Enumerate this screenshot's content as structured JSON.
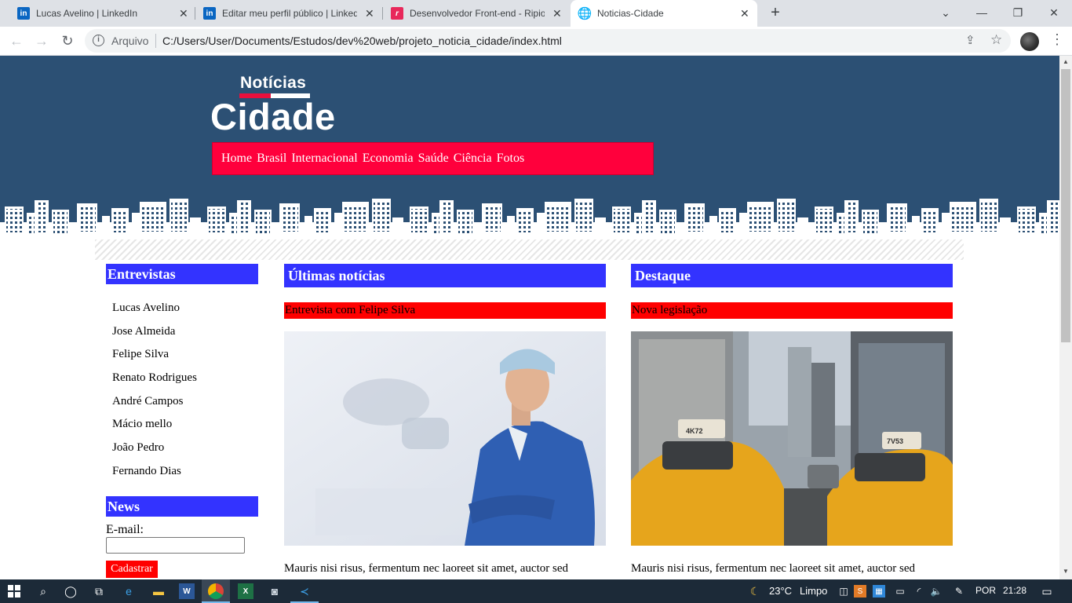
{
  "browser": {
    "tabs": [
      {
        "title": "Lucas Avelino | LinkedIn",
        "favicon": "linkedin-icon"
      },
      {
        "title": "Editar meu perfil público | LinkedIn",
        "favicon": "linkedin-icon"
      },
      {
        "title": "Desenvolvedor Front-end - Ripio",
        "favicon": "ripio-icon"
      },
      {
        "title": "Noticias-Cidade",
        "favicon": "globe-icon"
      }
    ],
    "favicon_letters": {
      "linkedin": "in",
      "ripio": "r"
    },
    "scheme_label": "Arquivo",
    "url": "C:/Users/User/Documents/Estudos/dev%20web/projeto_noticia_cidade/index.html"
  },
  "site": {
    "logo_top": "Notícias",
    "logo_main": "Cidade",
    "menu": [
      "Home",
      "Brasil",
      "Internacional",
      "Economia",
      "Saúde",
      "Ciência",
      "Fotos"
    ],
    "colors": {
      "header_bg": "#2c5074",
      "menu_bg": "#ff003c",
      "section_bg": "#3333ff",
      "subtitle_bg": "#ff0000"
    }
  },
  "sidebar": {
    "interviews_title": "Entrevistas",
    "interviews": [
      "Lucas Avelino",
      "Jose Almeida",
      "Felipe Silva",
      "Renato Rodrigues",
      "André Campos",
      "Mácio mello",
      "João Pedro",
      "Fernando Dias"
    ],
    "news_title": "News",
    "email_label": "E-mail:",
    "submit_label": "Cadastrar"
  },
  "latest": {
    "title": "Últimas notícias",
    "subtitle": "Entrevista com Felipe Silva",
    "body": "Mauris nisi risus, fermentum nec laoreet sit amet, auctor sed"
  },
  "featured": {
    "title": "Destaque",
    "subtitle": "Nova legislação",
    "body": "Mauris nisi risus, fermentum nec laoreet sit amet, auctor sed",
    "taxi_plates": [
      "4K72",
      "7V53"
    ]
  },
  "taskbar": {
    "weather": "23°C",
    "weather_desc": "Limpo",
    "lang": "POR",
    "time": "21:28"
  }
}
